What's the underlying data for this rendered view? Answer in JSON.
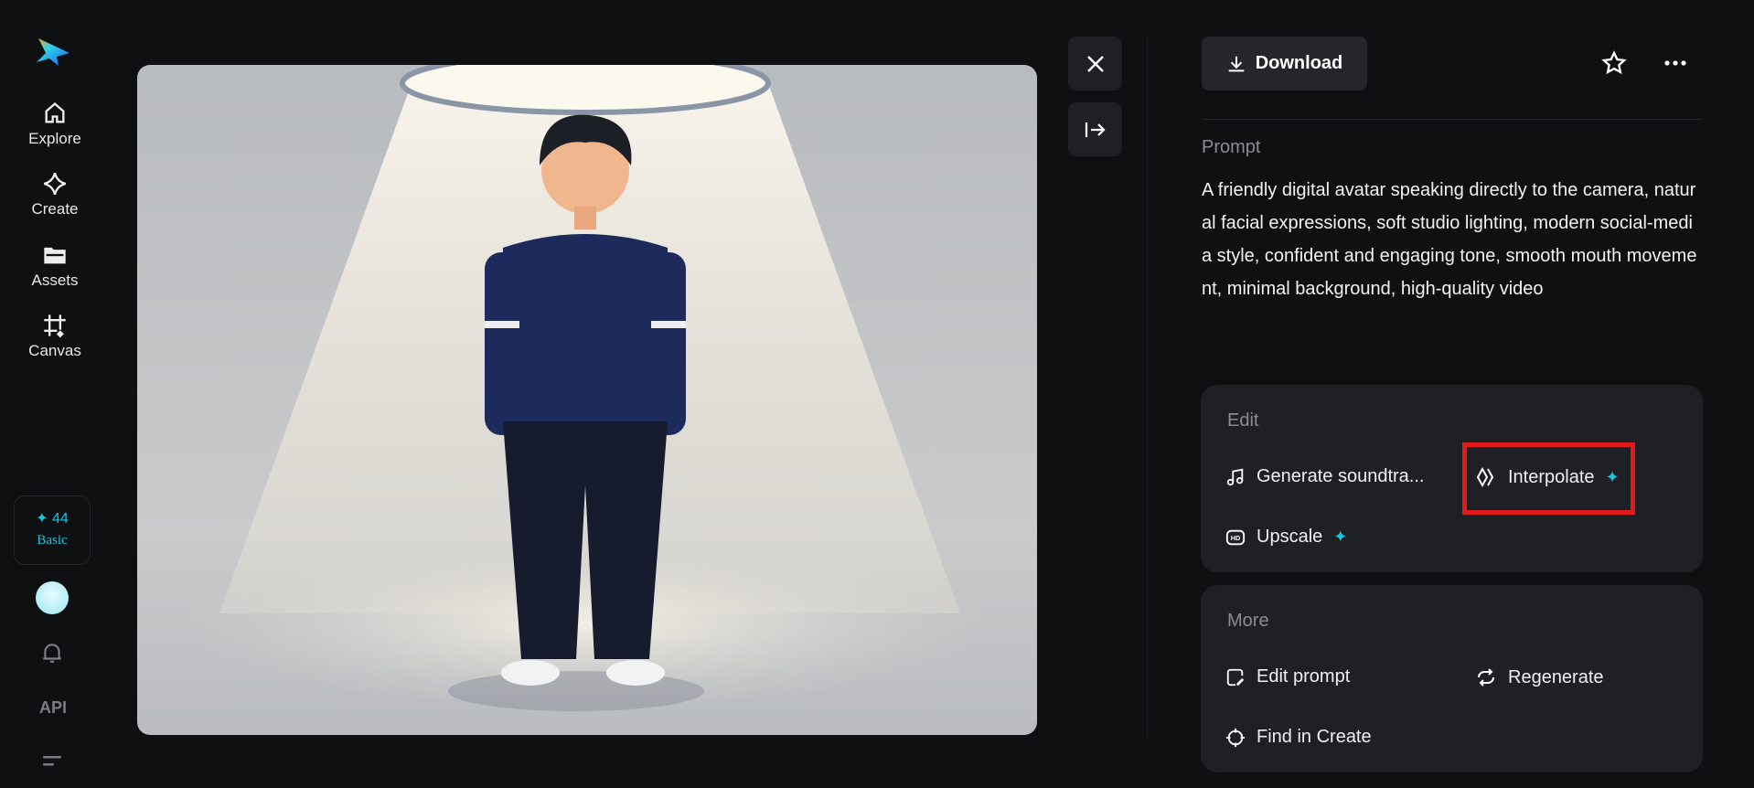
{
  "sidebar": {
    "items": [
      {
        "label": "Explore"
      },
      {
        "label": "Create"
      },
      {
        "label": "Assets"
      },
      {
        "label": "Canvas"
      }
    ],
    "credits": {
      "count": "44",
      "plan": "Basic"
    },
    "api_label": "API"
  },
  "toolbar": {
    "download_label": "Download"
  },
  "prompt": {
    "label": "Prompt",
    "text": "A friendly digital avatar speaking directly to the camera, natural facial expressions, soft studio lighting, modern social-media style, confident and engaging tone, smooth mouth movement, minimal background, high-quality video"
  },
  "edit": {
    "label": "Edit",
    "items": [
      {
        "label": "Generate soundtra..."
      },
      {
        "label": "Interpolate"
      },
      {
        "label": "Upscale"
      }
    ]
  },
  "more": {
    "label": "More",
    "items": [
      {
        "label": "Edit prompt"
      },
      {
        "label": "Regenerate"
      },
      {
        "label": "Find in Create"
      }
    ]
  },
  "colors": {
    "accent": "#19c6e0",
    "highlight": "#e01b1b",
    "panel": "#1f2024"
  }
}
